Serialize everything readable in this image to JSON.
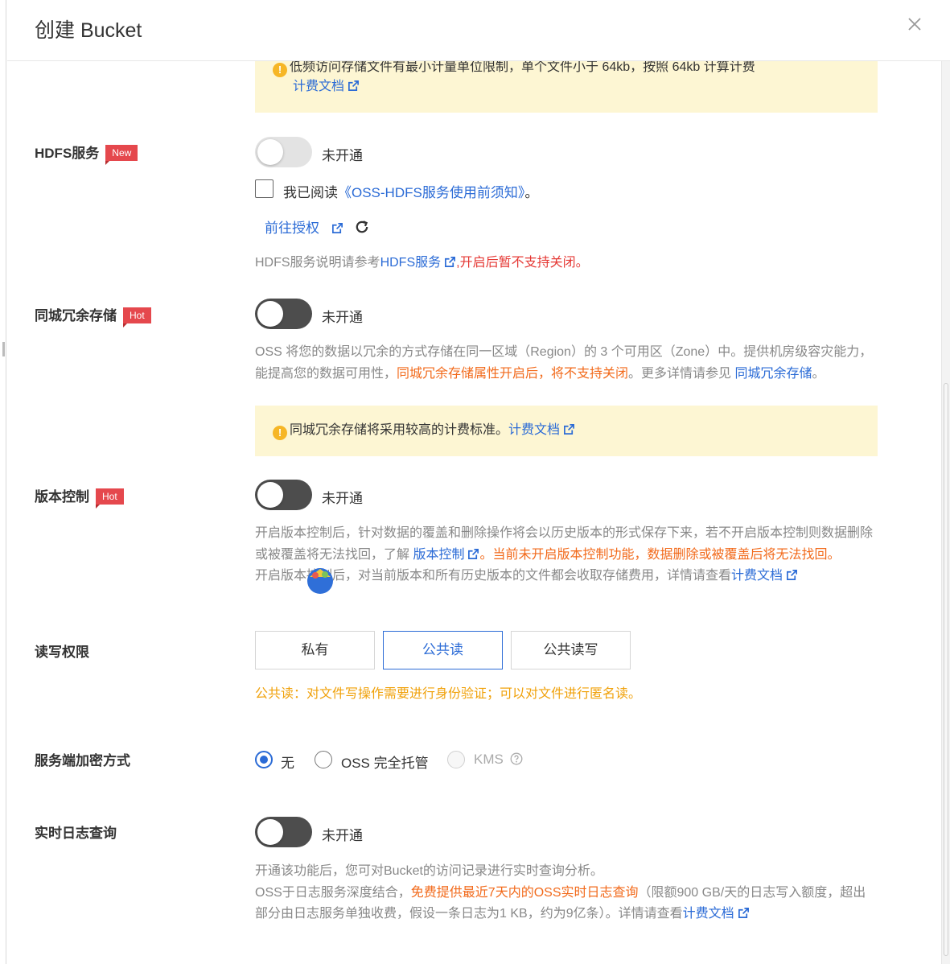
{
  "dialog": {
    "title": "创建 Bucket"
  },
  "billing_notice": {
    "text": "低频访问存储文件有最小计量单位限制，单个文件小于 64kb，按照 64kb 计算计费",
    "link": "计费文档"
  },
  "hdfs": {
    "label": "HDFS服务",
    "tag": "New",
    "toggle_status": "未开通",
    "agree_prefix": "我已阅读",
    "agree_link": "《OSS-HDFS服务使用前须知》",
    "agree_suffix": "。",
    "auth_link": "前往授权",
    "desc_prefix": "HDFS服务说明请参考",
    "desc_link": "HDFS服务",
    "desc_warning": ",开启后暂不支持关闭。"
  },
  "zrs": {
    "label": "同城冗余存储",
    "tag": "Hot",
    "toggle_status": "未开通",
    "desc_1": "OSS 将您的数据以冗余的方式存储在同一区域（Region）的 3 个可用区（Zone）中。提供机房级容灾能力，能提高您的数据可用性，",
    "desc_warning": "同城冗余存储属性开启后，将不支持关闭",
    "desc_2": "。更多详情请参见 ",
    "desc_link": "同城冗余存储",
    "desc_end": "。",
    "notice_text": "同城冗余存储将采用较高的计费标准。",
    "notice_link": "计费文档"
  },
  "versioning": {
    "label": "版本控制",
    "tag": "Hot",
    "toggle_status": "未开通",
    "desc_1": "开启版本控制后，针对数据的覆盖和删除操作将会以历史版本的形式保存下来，若不开启版本控制则数据删除或被覆盖将无法找回，了解 ",
    "desc_link": "版本控制",
    "desc_warning": "。当前未开启版本控制功能，数据删除或被覆盖后将无法找回。",
    "desc_2": "开启版本控制后，对当前版本和所有历史版本的文件都会收取存储费用，详情请查看",
    "desc_2_link": "计费文档"
  },
  "acl": {
    "label": "读写权限",
    "options": [
      "私有",
      "公共读",
      "公共读写"
    ],
    "selected": "公共读",
    "hint": "公共读：对文件写操作需要进行身份验证；可以对文件进行匿名读。"
  },
  "encryption": {
    "label": "服务端加密方式",
    "options": [
      "无",
      "OSS 完全托管",
      "KMS"
    ],
    "selected": "无"
  },
  "realtime_log": {
    "label": "实时日志查询",
    "toggle_status": "未开通",
    "desc_1": "开通该功能后，您可对Bucket的访问记录进行实时查询分析。",
    "desc_2": "OSS于日志服务深度结合，",
    "desc_highlight": "免费提供最近7天内的OSS实时日志查询",
    "desc_3": "（限额900 GB/天的日志写入额度，超出部分由日志服务单独收费，假设一条日志为1 KB，约为9亿条）。详情请查看",
    "desc_link": "计费文档"
  },
  "colors": {
    "link": "#2b6bd6",
    "warning_red": "#e53935",
    "warning_orange": "#f26a1b",
    "acl_hint": "#f0a10a",
    "notice_bg": "#fdf6d3"
  }
}
